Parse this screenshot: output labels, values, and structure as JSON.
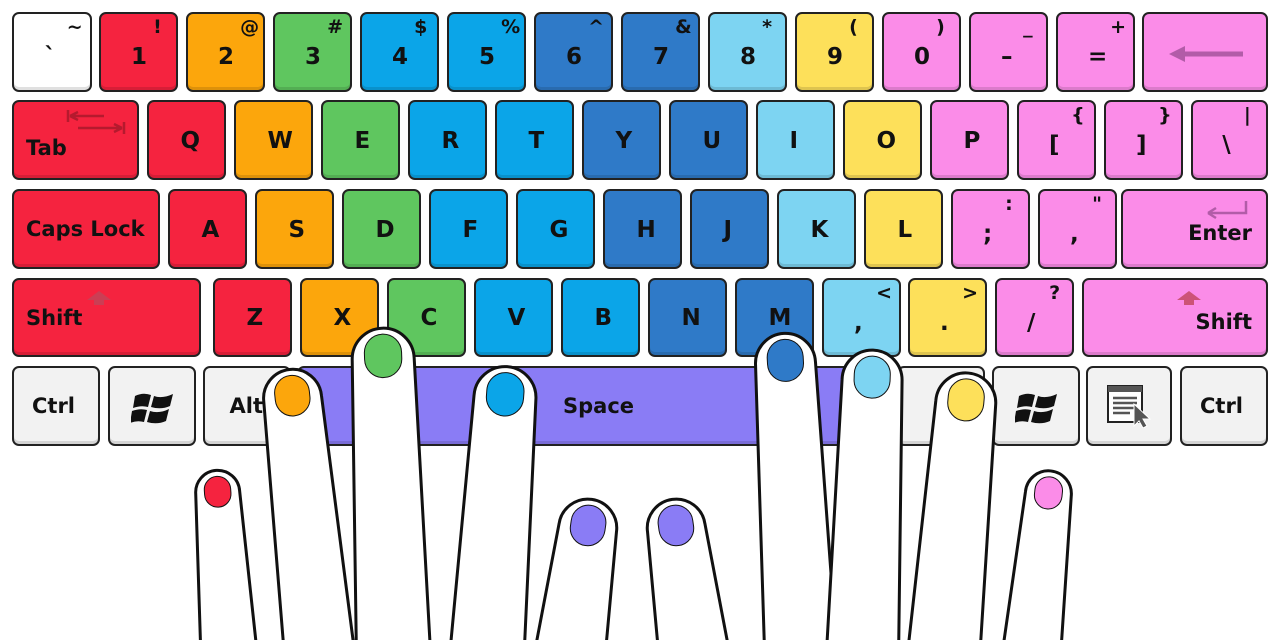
{
  "colors": {
    "white": "#ffffff",
    "gray": "#f2f2f2",
    "red": "#f5233f",
    "orange": "#fca60c",
    "green": "#5fc65f",
    "blue": "#0ba5e8",
    "darkblue": "#2f7ac8",
    "lightblue": "#7dd4f2",
    "yellow": "#fde05a",
    "pink": "#fb8ce8",
    "purple": "#8a7cf5"
  },
  "rows": [
    [
      {
        "main": "`",
        "shift": "~",
        "color": "white"
      },
      {
        "main": "1",
        "shift": "!",
        "color": "red"
      },
      {
        "main": "2",
        "shift": "@",
        "color": "orange"
      },
      {
        "main": "3",
        "shift": "#",
        "color": "green"
      },
      {
        "main": "4",
        "shift": "$",
        "color": "blue"
      },
      {
        "main": "5",
        "shift": "%",
        "color": "blue"
      },
      {
        "main": "6",
        "shift": "^",
        "color": "darkblue"
      },
      {
        "main": "7",
        "shift": "&",
        "color": "darkblue"
      },
      {
        "main": "8",
        "shift": "*",
        "color": "lightblue"
      },
      {
        "main": "9",
        "shift": "(",
        "color": "yellow"
      },
      {
        "main": "0",
        "shift": ")",
        "color": "pink"
      },
      {
        "main": "–",
        "shift": "_",
        "color": "pink"
      },
      {
        "main": "=",
        "shift": "+",
        "color": "pink"
      },
      {
        "icon": "backspace-arrow-icon",
        "color": "pink"
      }
    ],
    [
      {
        "word": "Tab",
        "icon": "tab-arrows-icon",
        "color": "red"
      },
      {
        "main": "Q",
        "color": "red"
      },
      {
        "main": "W",
        "color": "orange"
      },
      {
        "main": "E",
        "color": "green"
      },
      {
        "main": "R",
        "color": "blue"
      },
      {
        "main": "T",
        "color": "blue"
      },
      {
        "main": "Y",
        "color": "darkblue"
      },
      {
        "main": "U",
        "color": "darkblue"
      },
      {
        "main": "I",
        "color": "lightblue"
      },
      {
        "main": "O",
        "color": "yellow"
      },
      {
        "main": "P",
        "color": "pink"
      },
      {
        "main": "[",
        "shift": "{",
        "color": "pink"
      },
      {
        "main": "]",
        "shift": "}",
        "color": "pink"
      },
      {
        "main": "\\",
        "shift": "|",
        "color": "pink"
      }
    ],
    [
      {
        "word": "Caps Lock",
        "color": "red"
      },
      {
        "main": "A",
        "color": "red"
      },
      {
        "main": "S",
        "color": "orange"
      },
      {
        "main": "D",
        "color": "green"
      },
      {
        "main": "F",
        "color": "blue"
      },
      {
        "main": "G",
        "color": "blue"
      },
      {
        "main": "H",
        "color": "darkblue"
      },
      {
        "main": "J",
        "color": "darkblue"
      },
      {
        "main": "K",
        "color": "lightblue"
      },
      {
        "main": "L",
        "color": "yellow"
      },
      {
        "main": ";",
        "shift": ":",
        "color": "pink"
      },
      {
        "main": ",",
        "shift": "\"",
        "color": "pink"
      },
      {
        "word": "Enter",
        "icon": "enter-arrow-icon",
        "color": "pink"
      }
    ],
    [
      {
        "word": "Shift",
        "icon": "shift-arrow-icon",
        "color": "red"
      },
      {
        "main": "Z",
        "color": "red"
      },
      {
        "main": "X",
        "color": "orange"
      },
      {
        "main": "C",
        "color": "green"
      },
      {
        "main": "V",
        "color": "blue"
      },
      {
        "main": "B",
        "color": "blue"
      },
      {
        "main": "N",
        "color": "darkblue"
      },
      {
        "main": "M",
        "color": "darkblue"
      },
      {
        "main": ",",
        "shift": "<",
        "color": "lightblue"
      },
      {
        "main": ".",
        "shift": ">",
        "color": "yellow"
      },
      {
        "main": "/",
        "shift": "?",
        "color": "pink"
      },
      {
        "word": "Shift",
        "icon": "shift-arrow-icon",
        "color": "pink"
      }
    ],
    [
      {
        "word": "Ctrl",
        "color": "gray"
      },
      {
        "icon": "windows-logo-icon",
        "color": "gray"
      },
      {
        "word": "Alt",
        "color": "gray"
      },
      {
        "word": "Space",
        "color": "purple"
      },
      {
        "color": "gray"
      },
      {
        "icon": "windows-logo-icon",
        "color": "gray"
      },
      {
        "icon": "menu-key-icon",
        "color": "gray"
      },
      {
        "word": "Ctrl",
        "color": "gray"
      }
    ]
  ],
  "fingers": {
    "left": [
      "red",
      "orange",
      "green",
      "blue",
      "purple"
    ],
    "right": [
      "purple",
      "darkblue",
      "lightblue",
      "yellow",
      "pink"
    ]
  }
}
